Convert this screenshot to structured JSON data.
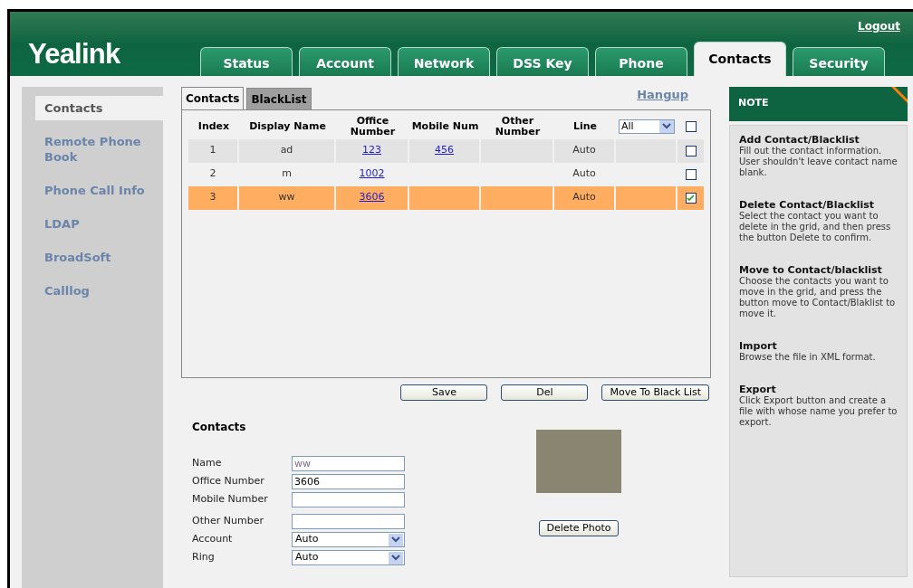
{
  "header": {
    "logo": "Yealink",
    "logout": "Logout",
    "tabs": [
      {
        "label": "Status",
        "selected": false
      },
      {
        "label": "Account",
        "selected": false
      },
      {
        "label": "Network",
        "selected": false
      },
      {
        "label": "DSS Key",
        "selected": false
      },
      {
        "label": "Phone",
        "selected": false
      },
      {
        "label": "Contacts",
        "selected": true
      },
      {
        "label": "Security",
        "selected": false
      }
    ]
  },
  "sidebar": {
    "items": [
      {
        "label": "Contacts",
        "selected": true
      },
      {
        "label": "Remote Phone Book",
        "selected": false
      },
      {
        "label": "Phone Call Info",
        "selected": false
      },
      {
        "label": "LDAP",
        "selected": false
      },
      {
        "label": "BroadSoft",
        "selected": false
      },
      {
        "label": "Calllog",
        "selected": false
      }
    ]
  },
  "subtabs": [
    {
      "label": "Contacts",
      "selected": true
    },
    {
      "label": "BlackList",
      "selected": false
    }
  ],
  "hangup": "Hangup",
  "table": {
    "columns": [
      "Index",
      "Display Name",
      "Office Number",
      "Mobile Num",
      "Other Number",
      "Line"
    ],
    "line_filter": "All",
    "select_all_checked": false,
    "rows": [
      {
        "index": "1",
        "name": "ad",
        "office": "123",
        "mobile": "456",
        "line": "Auto",
        "checked": false,
        "selected": false
      },
      {
        "index": "2",
        "name": "m",
        "office": "1002",
        "line": "Auto",
        "checked": false,
        "selected": false
      },
      {
        "index": "3",
        "name": "ww",
        "office": "3606",
        "line": "Auto",
        "checked": true,
        "selected": true
      }
    ]
  },
  "buttons": [
    "Save",
    "Del",
    "Move To Black List"
  ],
  "form": {
    "title": "Contacts",
    "fields": [
      {
        "kind": "text",
        "label": "Name",
        "value": "ww"
      },
      {
        "kind": "text",
        "label": "Office Number",
        "value": "3606"
      },
      {
        "kind": "text",
        "label": "Mobile Number"
      },
      {
        "kind": "text",
        "label": "Other Number"
      },
      {
        "kind": "select",
        "label": "Account",
        "value": "Auto"
      },
      {
        "kind": "select",
        "label": "Ring",
        "value": "Auto"
      }
    ],
    "delete_photo": "Delete Photo"
  },
  "note": {
    "title": "NOTE",
    "sections": [
      {
        "heading": "Add Contact/Blacklist",
        "text": "Fill out the contact information. User shouldn't leave contact name blank."
      },
      {
        "heading": "Delete Contact/Blacklist",
        "text": "Select the contact you want to delete in the grid, and then press the button Delete to confirm."
      },
      {
        "heading": "Move to Contact/blacklist",
        "text": "Choose the contacts you want to move in the grid, and press the button move to Contact/Blaklist to move it."
      },
      {
        "heading": "Import",
        "text": "Browse the file in XML format."
      },
      {
        "heading": "Export",
        "text": "Click Export button and create a file with whose name you prefer to export."
      }
    ]
  }
}
